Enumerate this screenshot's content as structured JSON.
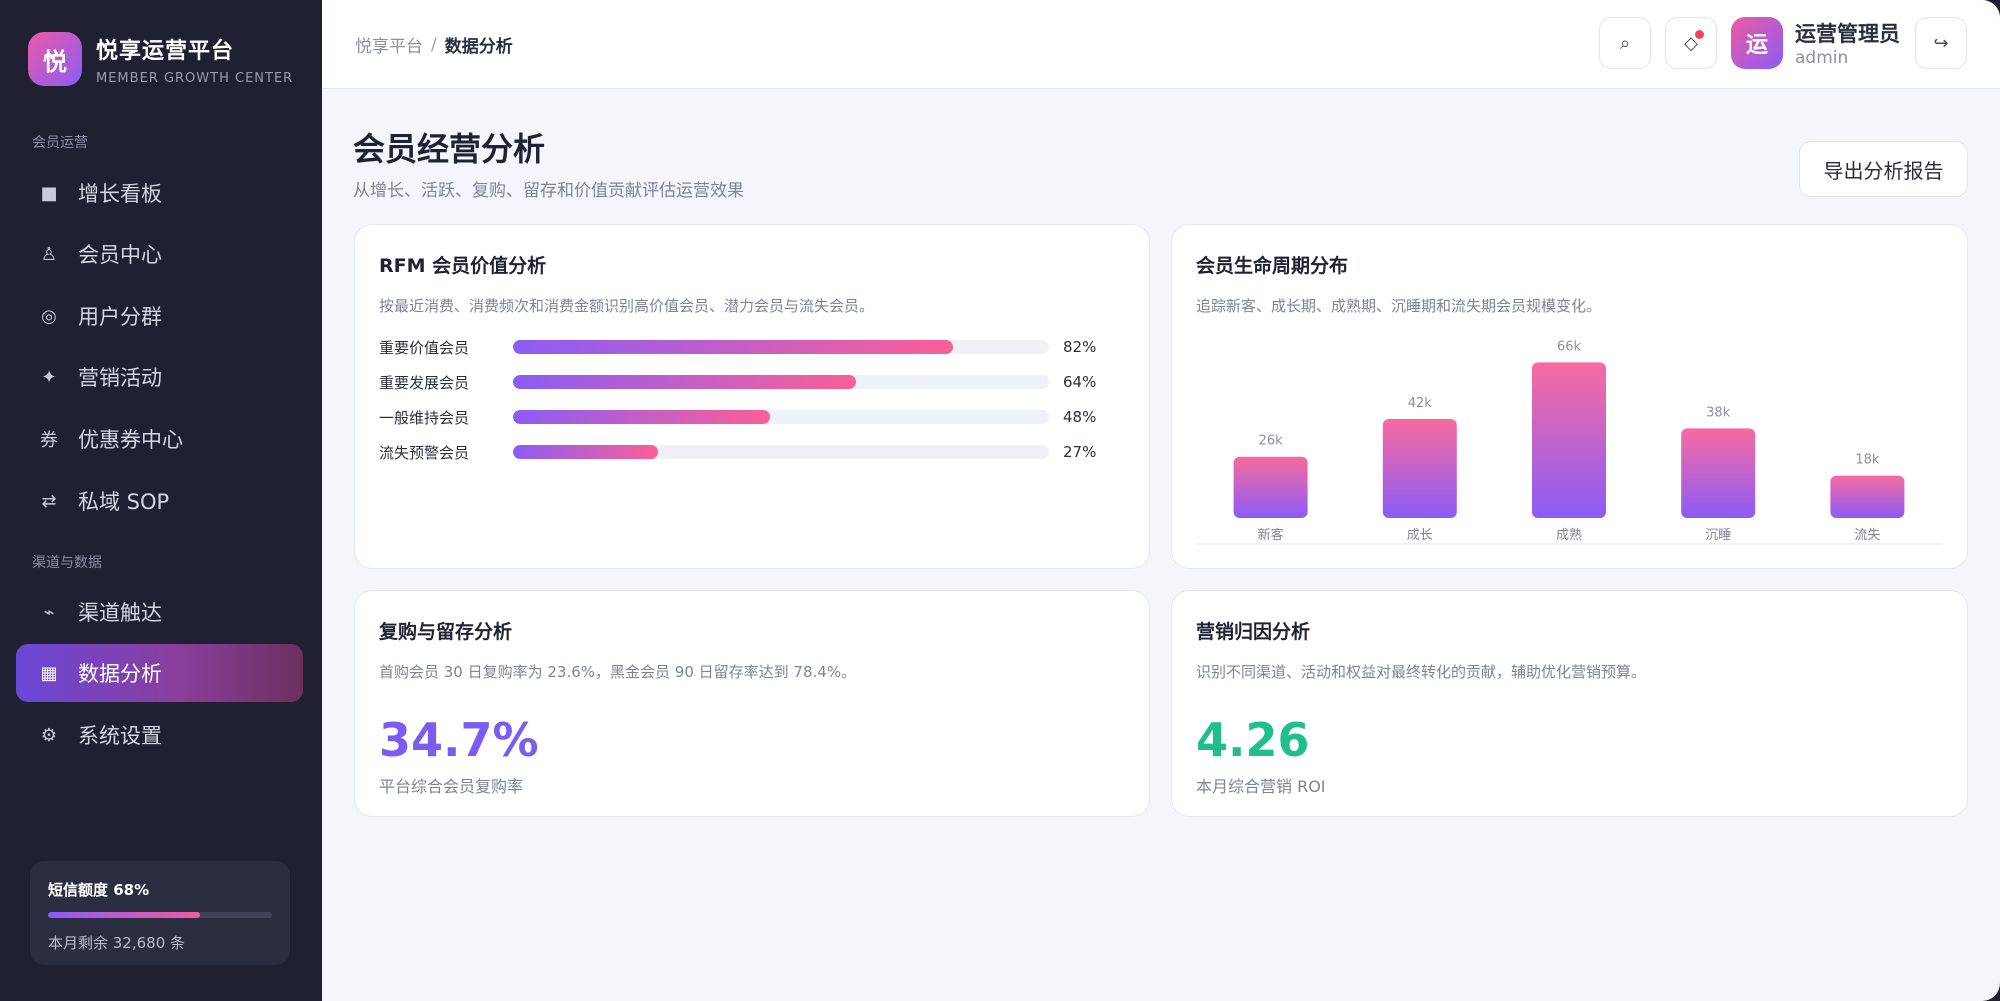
{
  "brand": {
    "logo_char": "悦",
    "title": "悦享运营平台",
    "subtitle": "MEMBER GROWTH CENTER"
  },
  "sidebar": {
    "sections": [
      {
        "label": "会员运营"
      },
      {
        "label": "渠道与数据"
      }
    ],
    "items": [
      {
        "label": "增长看板",
        "icon": "square-icon"
      },
      {
        "label": "会员中心",
        "icon": "person-icon"
      },
      {
        "label": "用户分群",
        "icon": "target-icon"
      },
      {
        "label": "营销活动",
        "icon": "sparkle-icon"
      },
      {
        "label": "优惠券中心",
        "icon": "coupon-icon"
      },
      {
        "label": "私域 SOP",
        "icon": "exchange-icon"
      },
      {
        "label": "渠道触达",
        "icon": "signal-icon"
      },
      {
        "label": "数据分析",
        "icon": "chart-icon",
        "active": true
      },
      {
        "label": "系统设置",
        "icon": "gear-icon"
      }
    ],
    "icon_glyphs": [
      "■",
      "♙",
      "◎",
      "✦",
      "券",
      "⇄",
      "⌁",
      "▦",
      "⚙"
    ],
    "quota": {
      "title": "短信额度 68%",
      "percent": 68,
      "remaining": "本月剩余 32,680 条"
    }
  },
  "topbar": {
    "breadcrumb_root": "悦享平台",
    "breadcrumb_sep": "/",
    "breadcrumb_current": "数据分析",
    "search_glyph": "⌕",
    "notify_glyph": "◇",
    "logout_glyph": "↪",
    "user": {
      "avatar_char": "运",
      "name": "运营管理员",
      "role": "admin"
    }
  },
  "page": {
    "title": "会员经营分析",
    "subtitle": "从增长、活跃、复购、留存和价值贡献评估运营效果",
    "export_label": "导出分析报告"
  },
  "rfm": {
    "title": "RFM 会员价值分析",
    "desc": "按最近消费、消费频次和消费金额识别高价值会员、潜力会员与流失会员。",
    "rows": [
      {
        "label": "重要价值会员",
        "percent": 82,
        "pct_text": "82%"
      },
      {
        "label": "重要发展会员",
        "percent": 64,
        "pct_text": "64%"
      },
      {
        "label": "一般维持会员",
        "percent": 48,
        "pct_text": "48%"
      },
      {
        "label": "流失预警会员",
        "percent": 27,
        "pct_text": "27%"
      }
    ]
  },
  "lifecycle": {
    "title": "会员生命周期分布",
    "desc": "追踪新客、成长期、成熟期、沉睡期和流失期会员规模变化。"
  },
  "chart_data": {
    "type": "bar",
    "categories": [
      "新客",
      "成长",
      "成熟",
      "沉睡",
      "流失"
    ],
    "values": [
      26,
      42,
      66,
      38,
      18
    ],
    "value_labels": [
      "26k",
      "42k",
      "66k",
      "38k",
      "18k"
    ],
    "ylim": [
      0,
      70
    ],
    "grid": false,
    "colors": {
      "top": "#f76ba0",
      "bottom": "#8b5cf6"
    }
  },
  "repurchase": {
    "title": "复购与留存分析",
    "desc": "首购会员 30 日复购率为 23.6%，黑金会员 90 日留存率达到 78.4%。",
    "value": "34.7%",
    "label": "平台综合会员复购率",
    "color": "#7b5cf0"
  },
  "attribution": {
    "title": "营销归因分析",
    "desc": "识别不同渠道、活动和权益对最终转化的贡献，辅助优化营销预算。",
    "value": "4.26",
    "label": "本月综合营销 ROI",
    "color": "#1fbf8c"
  }
}
